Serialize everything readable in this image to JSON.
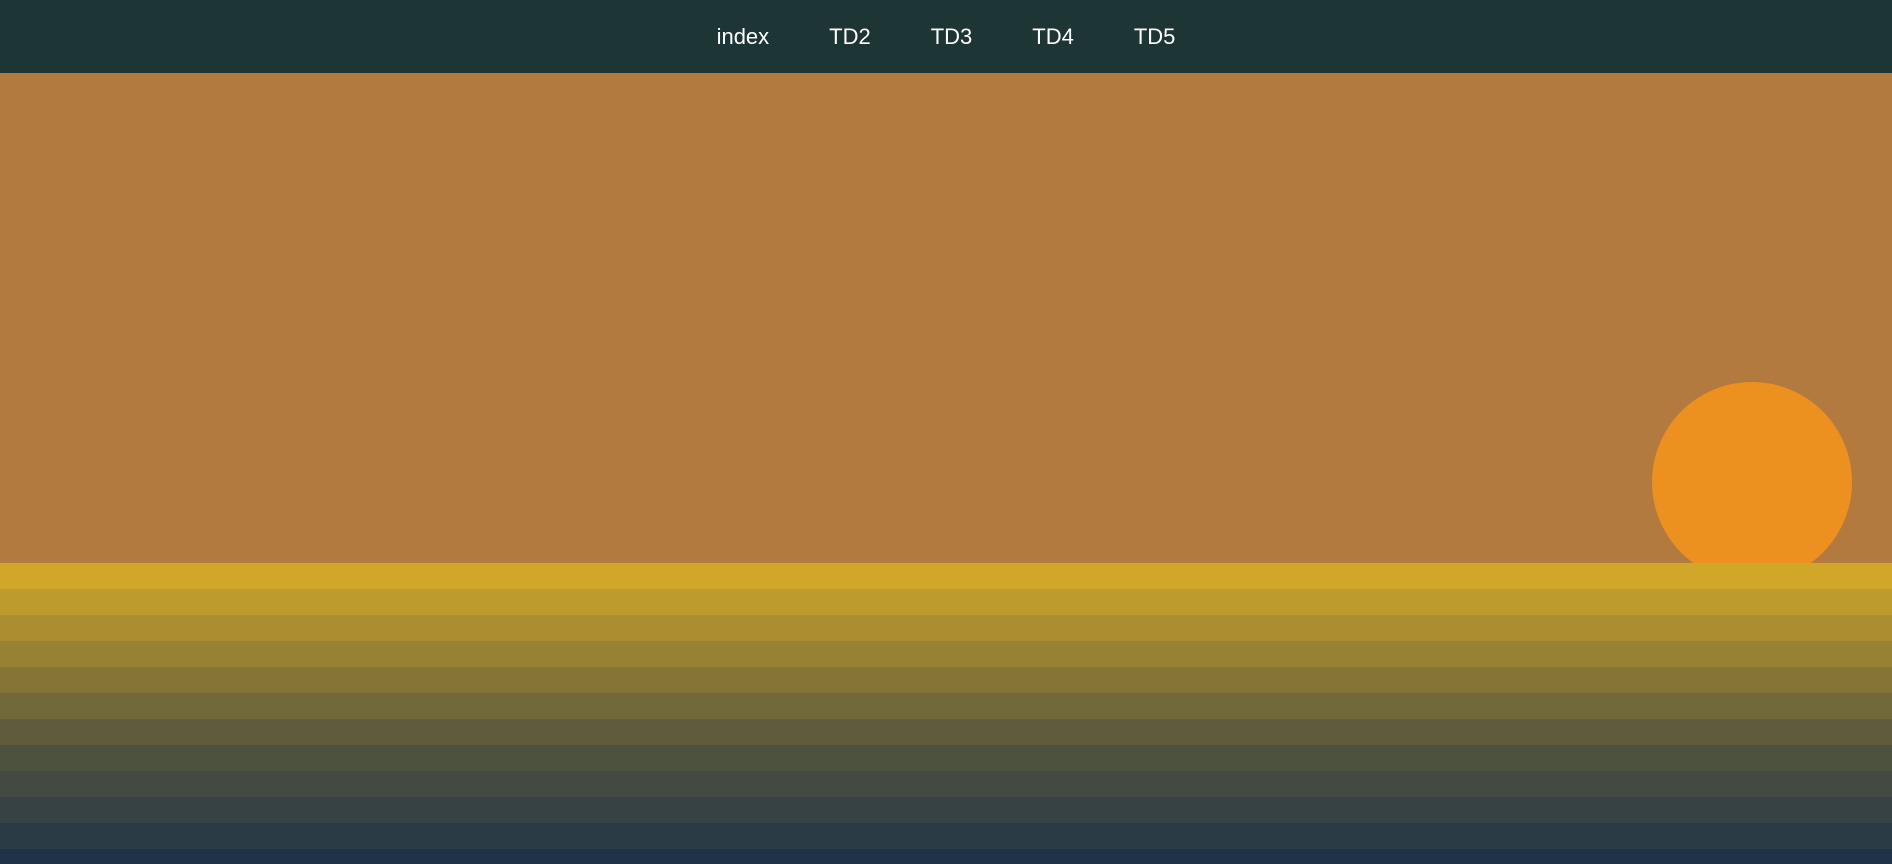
{
  "nav": {
    "links": [
      "index",
      "TD2",
      "TD3",
      "TD4",
      "TD5"
    ]
  },
  "colors": {
    "navbar": "#1d3534",
    "sky": "#b27a3e",
    "sun": "#ec9020",
    "sea_top": "#d1a72a",
    "sea_bottom": "#1f3348"
  }
}
